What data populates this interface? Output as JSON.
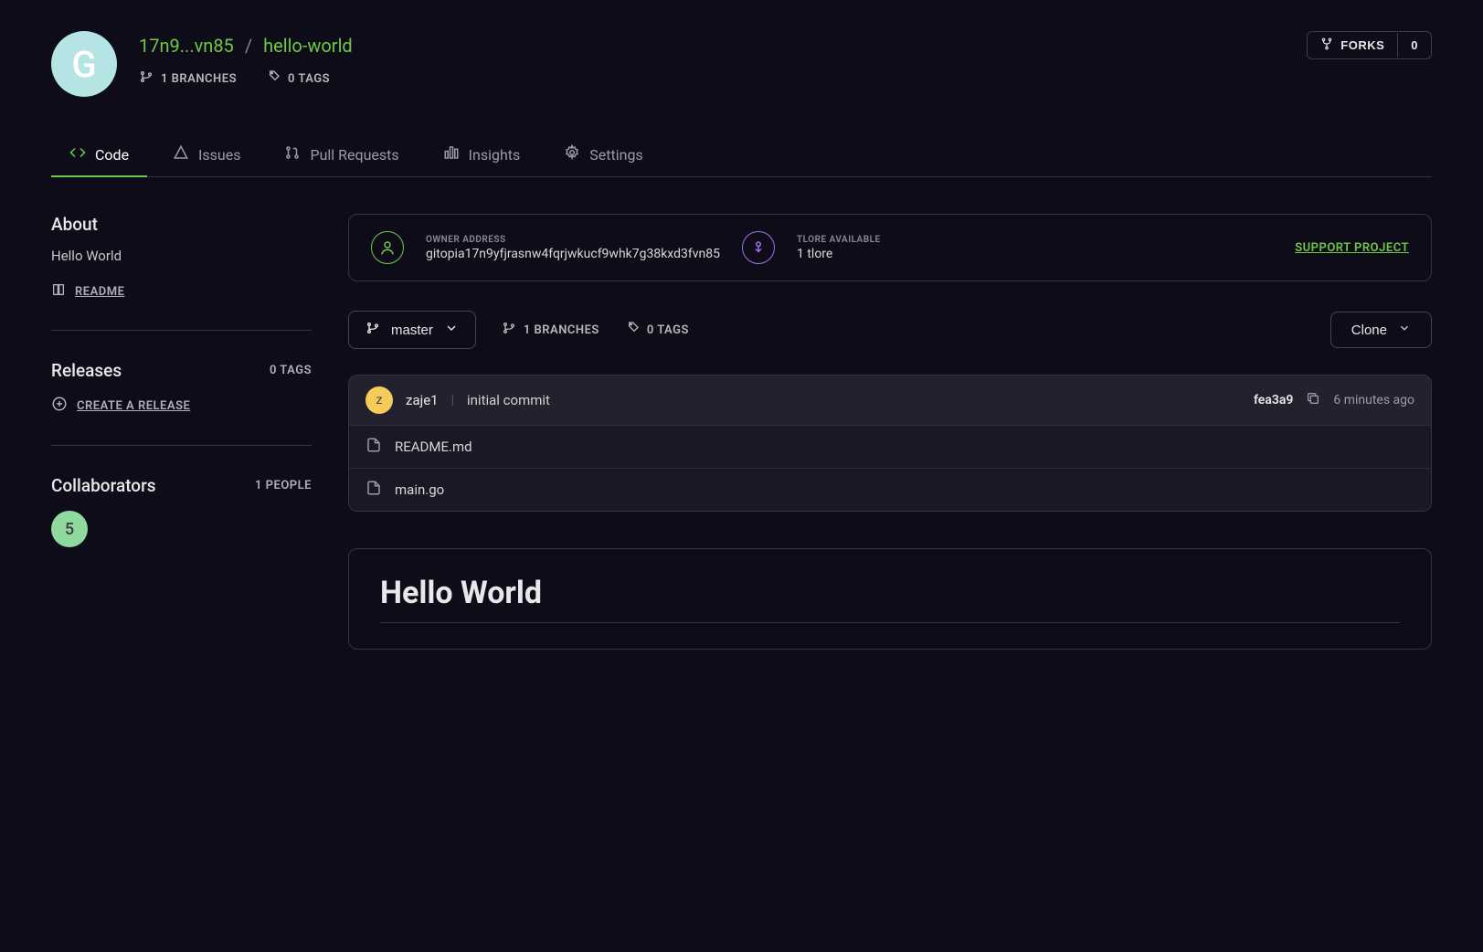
{
  "header": {
    "avatar_letter": "G",
    "owner_short": "17n9...vn85",
    "repo": "hello-world",
    "sep": "/",
    "branches": "1 BRANCHES",
    "tags": "0 TAGS",
    "forks_label": "FORKS",
    "forks_count": "0"
  },
  "tabs": {
    "code": "Code",
    "issues": "Issues",
    "pull_requests": "Pull Requests",
    "insights": "Insights",
    "settings": "Settings"
  },
  "sidebar": {
    "about_title": "About",
    "about_desc": "Hello World",
    "readme_label": "README",
    "releases_title": "Releases",
    "releases_count": "0 TAGS",
    "create_release": "CREATE A RELEASE",
    "collab_title": "Collaborators",
    "collab_count": "1 PEOPLE",
    "collab_avatar": "5"
  },
  "owner_card": {
    "owner_label": "OWNER ADDRESS",
    "owner_value": "gitopia17n9yfjrasnw4fqrjwkucf9whk7g38kxd3fvn85",
    "tlore_label": "TLORE AVAILABLE",
    "tlore_value": "1 tlore",
    "support": "SUPPORT PROJECT"
  },
  "toolbar": {
    "branch": "master",
    "branches": "1 BRANCHES",
    "tags": "0 TAGS",
    "clone": "Clone"
  },
  "commit": {
    "avatar": "z",
    "user": "zaje1",
    "msg": "initial commit",
    "hash": "fea3a9",
    "time": "6 minutes ago"
  },
  "files": [
    {
      "name": "README.md"
    },
    {
      "name": "main.go"
    }
  ],
  "readme": {
    "h1": "Hello World"
  }
}
